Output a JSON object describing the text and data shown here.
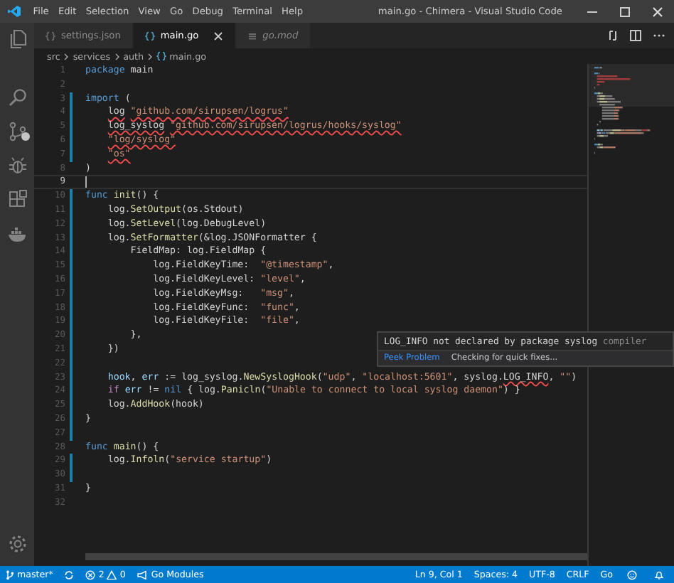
{
  "title_bar": {
    "menus": [
      "File",
      "Edit",
      "Selection",
      "View",
      "Go",
      "Debug",
      "Terminal",
      "Help"
    ],
    "title": "main.go - Chimera - Visual Studio Code"
  },
  "tabs": [
    {
      "label": "settings.json",
      "selected": false,
      "preview": false
    },
    {
      "label": "main.go",
      "selected": true,
      "preview": false
    },
    {
      "label": "go.mod",
      "selected": false,
      "preview": true
    }
  ],
  "breadcrumb": [
    "src",
    "services",
    "auth",
    "main.go"
  ],
  "code": [
    {
      "n": "1",
      "current": false,
      "modified": false,
      "tokens": [
        {
          "kind": "kw",
          "t": "package"
        },
        {
          "t": " main"
        }
      ]
    },
    {
      "n": "2",
      "current": false,
      "modified": false
    },
    {
      "n": "3",
      "current": false,
      "modified": true,
      "tokens": [
        {
          "kind": "kw",
          "t": "import"
        },
        {
          "t": " ("
        }
      ]
    },
    {
      "n": "4",
      "current": false,
      "modified": true,
      "tokens": [
        {
          "t": "    log ",
          "e": true
        },
        {
          "kind": "str",
          "t": "\"github.com/sirupsen/logrus\"",
          "e": true
        }
      ]
    },
    {
      "n": "5",
      "current": false,
      "modified": true,
      "tokens": [
        {
          "t": "    log_syslog ",
          "e": true
        },
        {
          "kind": "str",
          "t": "\"github.com/sirupsen/logrus/hooks/syslog\"",
          "e": true
        }
      ]
    },
    {
      "n": "6",
      "current": false,
      "modified": true,
      "tokens": [
        {
          "kind": "str",
          "t": "    \"log/syslog\"",
          "e": true
        }
      ]
    },
    {
      "n": "7",
      "current": false,
      "modified": true,
      "tokens": [
        {
          "kind": "str",
          "t": "    \"os\"",
          "e": true
        }
      ]
    },
    {
      "n": "8",
      "current": false,
      "modified": false,
      "tokens": [
        {
          "t": ")"
        }
      ]
    },
    {
      "n": "9",
      "current": true,
      "modified": false
    },
    {
      "n": "10",
      "current": false,
      "modified": true,
      "tokens": [
        {
          "kind": "kw",
          "t": "func "
        },
        {
          "kind": "fn",
          "t": "init"
        },
        {
          "t": "() {"
        }
      ]
    },
    {
      "n": "11",
      "current": false,
      "modified": true,
      "tokens": [
        {
          "t": "    log."
        },
        {
          "kind": "fn",
          "t": "SetOutput"
        },
        {
          "t": "(os.Stdout)"
        }
      ]
    },
    {
      "n": "12",
      "current": false,
      "modified": true,
      "tokens": [
        {
          "t": "    log."
        },
        {
          "kind": "fn",
          "t": "SetLevel"
        },
        {
          "t": "(log.DebugLevel)"
        }
      ]
    },
    {
      "n": "13",
      "current": false,
      "modified": true,
      "tokens": [
        {
          "t": "    log."
        },
        {
          "kind": "fn",
          "t": "SetFormatter"
        },
        {
          "t": "(&log.JSONFormatter {"
        }
      ]
    },
    {
      "n": "14",
      "current": false,
      "modified": true,
      "tokens": [
        {
          "t": "        FieldMap: log.FieldMap {"
        }
      ]
    },
    {
      "n": "15",
      "current": false,
      "modified": true,
      "tokens": [
        {
          "t": "            log.FieldKeyTime:  "
        },
        {
          "kind": "str",
          "t": "\"@timestamp\""
        },
        {
          "t": ","
        }
      ]
    },
    {
      "n": "16",
      "current": false,
      "modified": true,
      "tokens": [
        {
          "t": "            log.FieldKeyLevel: "
        },
        {
          "kind": "str",
          "t": "\"level\""
        },
        {
          "t": ","
        }
      ]
    },
    {
      "n": "17",
      "current": false,
      "modified": true,
      "tokens": [
        {
          "t": "            log.FieldKeyMsg:   "
        },
        {
          "kind": "str",
          "t": "\"msg\""
        },
        {
          "t": ","
        }
      ]
    },
    {
      "n": "18",
      "current": false,
      "modified": true,
      "tokens": [
        {
          "t": "            log.FieldKeyFunc:  "
        },
        {
          "kind": "str",
          "t": "\"func\""
        },
        {
          "t": ","
        }
      ]
    },
    {
      "n": "19",
      "current": false,
      "modified": true,
      "tokens": [
        {
          "t": "            log.FieldKeyFile:  "
        },
        {
          "kind": "str",
          "t": "\"file\""
        },
        {
          "t": ","
        }
      ]
    },
    {
      "n": "20",
      "current": false,
      "modified": true,
      "tokens": [
        {
          "t": "        },"
        }
      ]
    },
    {
      "n": "21",
      "current": false,
      "modified": true,
      "tokens": [
        {
          "t": "    })"
        }
      ]
    },
    {
      "n": "22",
      "current": false,
      "modified": true
    },
    {
      "n": "23",
      "current": false,
      "modified": true,
      "tokens": [
        {
          "kind": "var",
          "t": "    hook"
        },
        {
          "t": ", "
        },
        {
          "kind": "var",
          "t": "err"
        },
        {
          "t": " := log_syslog."
        },
        {
          "kind": "fn",
          "t": "NewSyslogHook"
        },
        {
          "t": "("
        },
        {
          "kind": "str",
          "t": "\"udp\""
        },
        {
          "t": ", "
        },
        {
          "kind": "str",
          "t": "\"localhost:5601\""
        },
        {
          "t": ", syslog."
        },
        {
          "t": "LOG_INFO",
          "e": true
        },
        {
          "t": ", "
        },
        {
          "kind": "str",
          "t": "\"\""
        },
        {
          "t": ")"
        }
      ]
    },
    {
      "n": "24",
      "current": false,
      "modified": true,
      "tokens": [
        {
          "kind": "ctrl",
          "t": "    if "
        },
        {
          "kind": "var",
          "t": "err"
        },
        {
          "t": " != "
        },
        {
          "kind": "kw",
          "t": "nil"
        },
        {
          "t": " { log."
        },
        {
          "kind": "fn",
          "t": "Panicln"
        },
        {
          "t": "("
        },
        {
          "kind": "str",
          "t": "\"Unable to connect to local syslog daemon\""
        },
        {
          "t": ") }"
        }
      ]
    },
    {
      "n": "25",
      "current": false,
      "modified": true,
      "tokens": [
        {
          "t": "    log."
        },
        {
          "kind": "fn",
          "t": "AddHook"
        },
        {
          "t": "(hook)"
        }
      ]
    },
    {
      "n": "26",
      "current": false,
      "modified": true,
      "tokens": [
        {
          "t": "}"
        }
      ]
    },
    {
      "n": "27",
      "current": false,
      "modified": true
    },
    {
      "n": "28",
      "current": false,
      "modified": false,
      "tokens": [
        {
          "kind": "kw",
          "t": "func "
        },
        {
          "kind": "fn",
          "t": "main"
        },
        {
          "t": "() {"
        }
      ]
    },
    {
      "n": "29",
      "current": false,
      "modified": true,
      "tokens": [
        {
          "t": "    log."
        },
        {
          "kind": "fn",
          "t": "Infoln"
        },
        {
          "t": "("
        },
        {
          "kind": "str",
          "t": "\"service startup\""
        },
        {
          "t": ")"
        }
      ]
    },
    {
      "n": "30",
      "current": false,
      "modified": true
    },
    {
      "n": "31",
      "current": false,
      "modified": false,
      "tokens": [
        {
          "t": "}"
        }
      ]
    },
    {
      "n": "32",
      "current": false,
      "modified": false
    }
  ],
  "hover": {
    "message": "LOG_INFO not declared by package syslog",
    "source": "compiler",
    "action": "Peek Problem",
    "status": "Checking for quick fixes..."
  },
  "status_bar": {
    "branch": "master*",
    "errors": "2",
    "warnings": "0",
    "module": "Go Modules",
    "position": "Ln 9, Col 1",
    "indent": "Spaces: 4",
    "encoding": "UTF-8",
    "eol": "CRLF",
    "language": "Go"
  }
}
